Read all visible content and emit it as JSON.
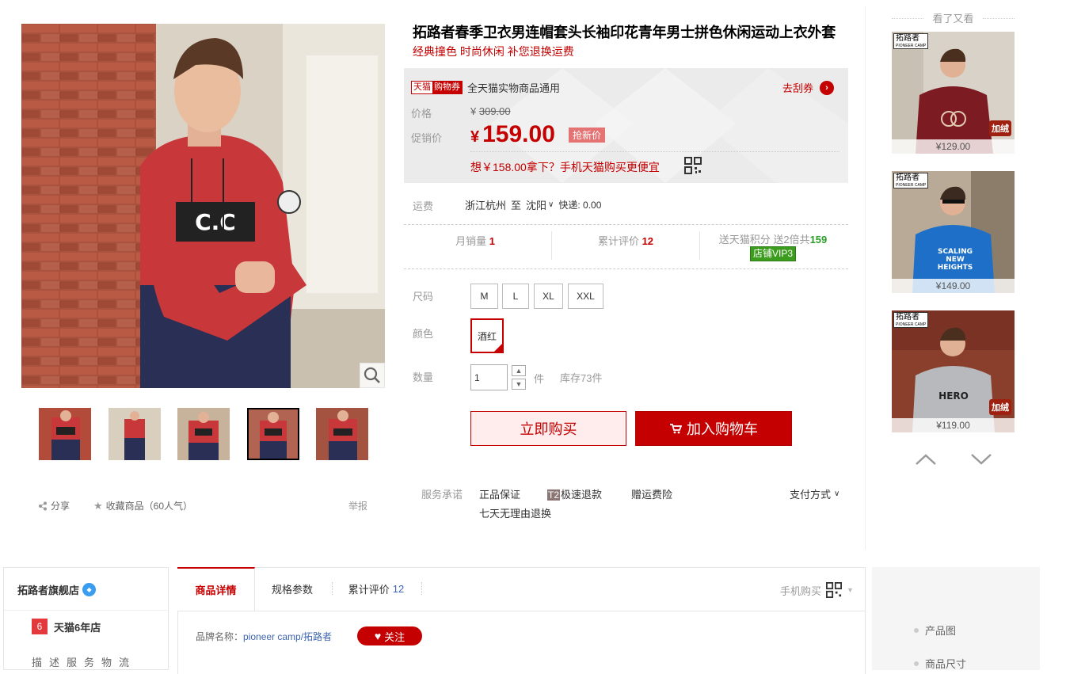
{
  "product": {
    "title": "拓路者春季卫衣男连帽套头长袖印花青年男士拼色休闲运动上衣外套",
    "subtitle": "经典撞色 时尚休闲 补您退换运费"
  },
  "coupon": {
    "tag_left": "天猫",
    "tag_right": "购物券",
    "text": "全天猫实物商品通用",
    "link": "去刮券"
  },
  "price": {
    "orig_label": "价格",
    "currency": "¥",
    "orig_value": "309.00",
    "promo_label": "促销价",
    "promo_value": "159.00",
    "promo_tag": "抢新价",
    "mobile_deal": "想￥158.00拿下？手机天猫购买更便宜"
  },
  "shipping": {
    "label": "运费",
    "from": "浙江杭州",
    "to_prefix": "至",
    "to": "沈阳",
    "express": "快递: 0.00"
  },
  "stats": {
    "monthly_label": "月销量",
    "monthly_value": "1",
    "reviews_label": "累计评价",
    "reviews_value": "12",
    "points_label": "送天猫积分 送2倍共",
    "points_value": "159",
    "vip": "店铺VIP3"
  },
  "options": {
    "size_label": "尺码",
    "sizes": [
      "M",
      "L",
      "XL",
      "XXL"
    ],
    "color_label": "颜色",
    "color_value": "酒红",
    "qty_label": "数量",
    "qty_value": "1",
    "qty_unit": "件",
    "stock": "库存73件"
  },
  "actions": {
    "buy_now": "立即购买",
    "add_cart": "加入购物车"
  },
  "service": {
    "label": "服务承诺",
    "items": [
      "正品保证",
      "极速退款",
      "赠运费险",
      "七天无理由退换"
    ],
    "t2": "T2",
    "pay": "支付方式"
  },
  "gallery": {
    "share": "分享",
    "collect": "收藏商品（60人气）",
    "report": "举报"
  },
  "rail": {
    "title": "看了又看",
    "logo": "拓路者",
    "logo_sub": "PIONEER CAMP",
    "items": [
      {
        "price": "¥129.00",
        "badge": "加绒"
      },
      {
        "price": "¥149.00",
        "badge": ""
      },
      {
        "price": "¥119.00",
        "badge": "加绒"
      }
    ]
  },
  "shop": {
    "name": "拓路者旗舰店",
    "years_num": "6",
    "years_text": "天猫6年店",
    "dsr": "描述服务物流"
  },
  "tabs": {
    "detail": "商品详情",
    "spec": "规格参数",
    "reviews": "累计评价",
    "reviews_count": "12",
    "mobile": "手机购买"
  },
  "detail": {
    "brand_label": "品牌名称：",
    "brand_value": "pioneer camp/拓路者",
    "follow": "关注"
  },
  "side_nav": [
    "产品图",
    "商品尺寸"
  ],
  "colors": {
    "accent": "#c40000",
    "link": "#3e66b1",
    "hoodie_red": "#c8383a",
    "hoodie_navy": "#2a2f55"
  }
}
